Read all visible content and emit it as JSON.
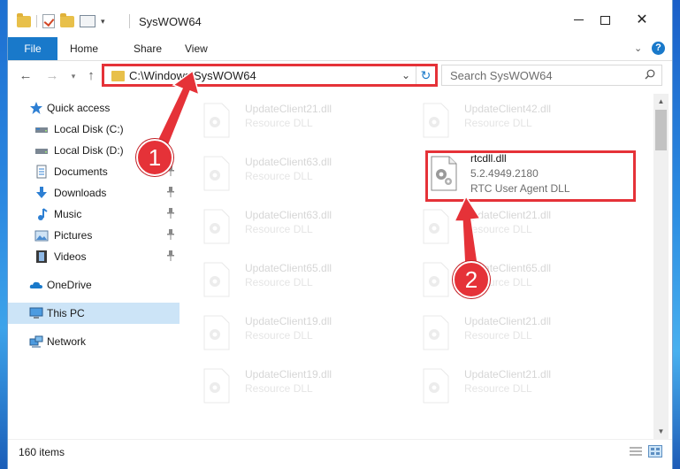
{
  "window": {
    "title": "SysWOW64"
  },
  "ribbon": {
    "tabs": [
      "File",
      "Home",
      "Share",
      "View"
    ]
  },
  "navigation": {
    "address": "C:\\Windows\\SysWOW64",
    "search_placeholder": "Search SysWOW64"
  },
  "sidebar": {
    "items": [
      {
        "label": "Quick access",
        "icon": "star-icon",
        "pinned": false
      },
      {
        "label": "Local Disk (C:)",
        "icon": "drive-icon",
        "pinned": false
      },
      {
        "label": "Local Disk (D:)",
        "icon": "drive-icon",
        "pinned": false
      },
      {
        "label": "Documents",
        "icon": "documents-icon",
        "pinned": true
      },
      {
        "label": "Downloads",
        "icon": "download-icon",
        "pinned": true
      },
      {
        "label": "Music",
        "icon": "music-icon",
        "pinned": true
      },
      {
        "label": "Pictures",
        "icon": "pictures-icon",
        "pinned": true
      },
      {
        "label": "Videos",
        "icon": "videos-icon",
        "pinned": true
      },
      {
        "label": "OneDrive",
        "icon": "cloud-icon",
        "pinned": false
      },
      {
        "label": "This PC",
        "icon": "computer-icon",
        "pinned": false,
        "selected": true
      },
      {
        "label": "Network",
        "icon": "network-icon",
        "pinned": false
      }
    ]
  },
  "files": {
    "left_column": [
      {
        "name": "UpdateClient21.dll",
        "type": "Resource DLL"
      },
      {
        "name": "UpdateClient63.dll",
        "type": "Resource DLL"
      },
      {
        "name": "UpdateClient63.dll",
        "type": "Resource DLL"
      },
      {
        "name": "UpdateClient65.dll",
        "type": "Resource DLL"
      },
      {
        "name": "UpdateClient19.dll",
        "type": "Resource DLL"
      },
      {
        "name": "UpdateClient19.dll",
        "type": "Resource DLL"
      }
    ],
    "right_column": [
      {
        "name": "UpdateClient42.dll",
        "type": "Resource DLL"
      },
      {
        "name": "UpdateClient21.dll",
        "type": "Resource DLL"
      },
      {
        "name": "UpdateClient65.dll",
        "type": "Resource DLL"
      },
      {
        "name": "UpdateClient21.dll",
        "type": "Resource DLL"
      },
      {
        "name": "UpdateClient21.dll",
        "type": "Resource DLL"
      }
    ],
    "highlighted": {
      "name": "rtcdll.dll",
      "version": "5.2.4949.2180",
      "description": "RTC User Agent DLL"
    }
  },
  "status": {
    "item_count": "160 items"
  },
  "annotations": {
    "step1": "1",
    "step2": "2",
    "color": "#e53238"
  }
}
